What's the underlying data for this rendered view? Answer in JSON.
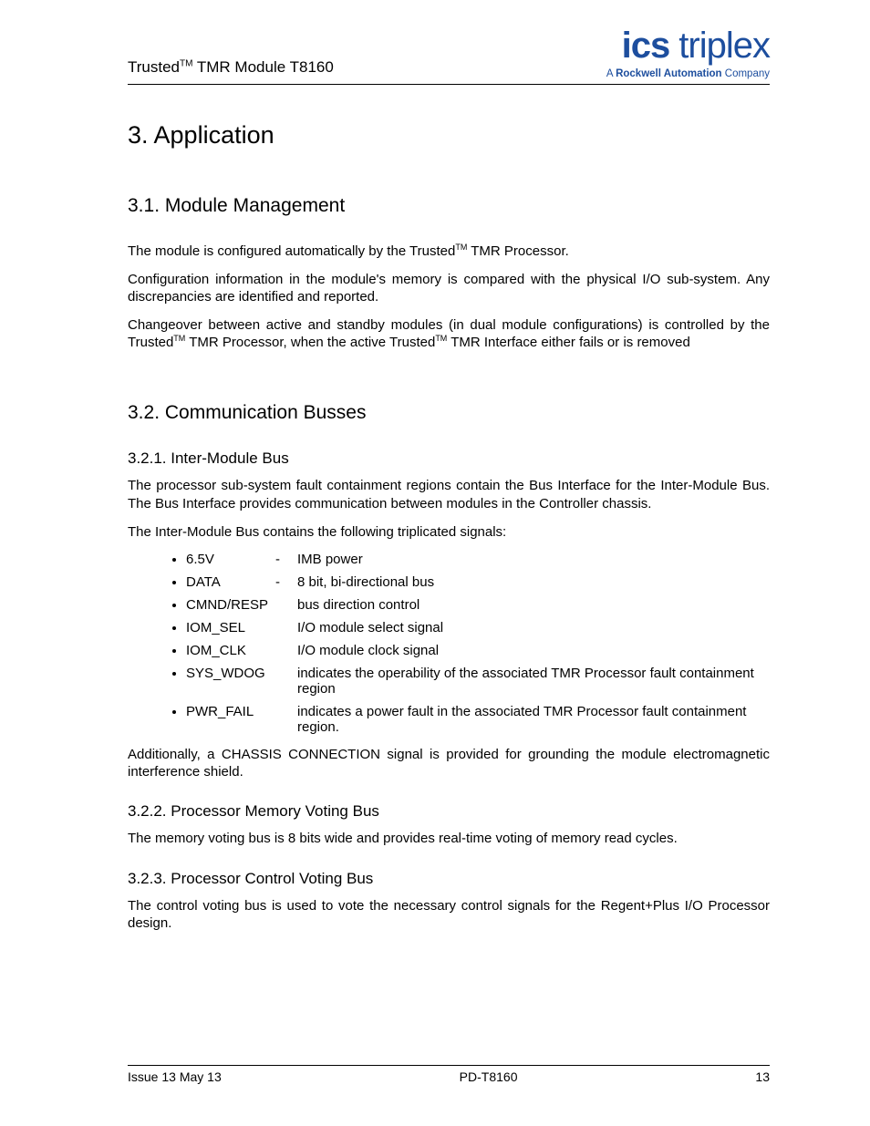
{
  "header": {
    "doc_title_prefix": "Trusted",
    "doc_title_tm": "TM",
    "doc_title_suffix": " TMR Module T8160",
    "brand_ics": "ics",
    "brand_triplex": " triplex",
    "brand_sub_prefix": "A ",
    "brand_sub_bold": "Rockwell Automation",
    "brand_sub_suffix": " Company"
  },
  "h1": "3.   Application",
  "sec31": {
    "title": "3.1. Module Management",
    "p1_a": "The module is configured automatically by the Trusted",
    "p1_tm": "TM",
    "p1_b": " TMR Processor.",
    "p2": "Configuration information in the module's memory is compared with the physical I/O sub-system.  Any discrepancies are identified and reported.",
    "p3_a": "Changeover between active and standby modules (in dual module configurations) is controlled by the Trusted",
    "p3_tm1": "TM",
    "p3_b": " TMR Processor, when the active Trusted",
    "p3_tm2": "TM",
    "p3_c": " TMR Interface either fails or is removed"
  },
  "sec32": {
    "title": "3.2. Communication Busses",
    "s321": {
      "title": "3.2.1.  Inter-Module Bus",
      "p1": "The processor sub-system fault containment regions contain the Bus Interface for the Inter-Module Bus.  The Bus Interface provides communication between modules in the Controller chassis.",
      "p2": "The Inter-Module Bus contains the following triplicated signals:",
      "signals": [
        {
          "name": "6.5V",
          "dash": "-",
          "desc": "IMB power"
        },
        {
          "name": "DATA",
          "dash": "-",
          "desc": "8 bit, bi-directional bus"
        },
        {
          "name": "CMND/RESP",
          "dash": "",
          "desc": "bus direction control"
        },
        {
          "name": "IOM_SEL",
          "dash": "",
          "desc": "I/O module select signal"
        },
        {
          "name": "IOM_CLK",
          "dash": "",
          "desc": "I/O module clock signal"
        },
        {
          "name": "SYS_WDOG",
          "dash": "",
          "desc": "indicates the operability of the associated TMR Processor fault containment region"
        },
        {
          "name": "PWR_FAIL",
          "dash": "",
          "desc": "indicates a power fault in the associated TMR Processor fault containment region."
        }
      ],
      "p3": "Additionally, a CHASSIS CONNECTION signal is provided for grounding the module electromagnetic interference shield."
    },
    "s322": {
      "title": "3.2.2.  Processor Memory Voting Bus",
      "p1": "The memory voting bus is 8 bits wide and provides real-time voting of memory read cycles."
    },
    "s323": {
      "title": "3.2.3.  Processor Control Voting Bus",
      "p1": "The control voting bus is used to vote the necessary control signals for the Regent+Plus I/O Processor design."
    }
  },
  "footer": {
    "left": "Issue 13 May 13",
    "center": "PD-T8160",
    "right": "13"
  }
}
